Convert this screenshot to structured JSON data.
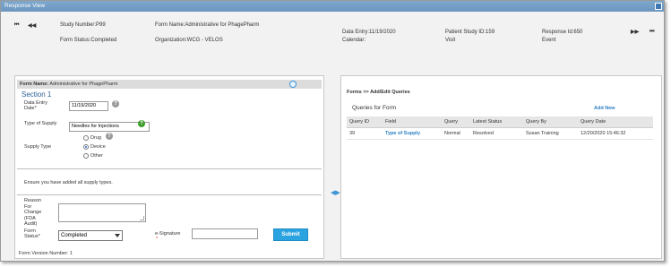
{
  "window": {
    "title": "Response View"
  },
  "header": {
    "study_number": "Study Number:P99",
    "form_name": "Form Name:Administrative for PhagePharm",
    "form_status": "Form Status:Completed",
    "organization": "Organization:WCG - VELOS",
    "data_entry": "Data Entry:11/19/2020",
    "calendar": "Calendar:",
    "patient_study_id": "Patient Study ID:159",
    "visit": "Visit",
    "response_id": "Response Id:650",
    "event": "Event",
    "nav_first": "⏮",
    "nav_prev": "◀◀",
    "nav_next": "▶▶",
    "nav_last": "⏭"
  },
  "form": {
    "name_label": "Form Name:",
    "name_value": "Administrative for PhagePharm",
    "section_title": "Section 1",
    "data_entry_label_1": "Data Entry",
    "data_entry_label_2": "Date*",
    "data_entry_value": "11/19/2020",
    "type_of_supply_label": "Type of Supply",
    "type_of_supply_value": "Needles for Injections",
    "supply_type_label": "Supply Type",
    "supply_options": [
      "Drug",
      "Device",
      "Other"
    ],
    "supply_selected": "Device",
    "note": "Ensure you have added all supply types.",
    "reason_label": [
      "Reason",
      "For",
      "Change",
      "(FDA",
      "Audit)"
    ],
    "form_status_label_1": "Form",
    "form_status_label_2": "Status*",
    "form_status_value": "Completed",
    "esignature_label": "e-Signature",
    "esignature_required": "*",
    "submit_label": "Submit",
    "version": "Form Version Number: 1",
    "help_glyph": "?"
  },
  "queries": {
    "breadcrumb": "Forms >> Add/Edit Queries",
    "title": "Queries for Form",
    "add_new": "Add New",
    "columns": [
      "Query ID",
      "Field",
      "Query",
      "Latest Status",
      "Query By",
      "Query Date"
    ],
    "rows": [
      [
        "39",
        "Type of Supply",
        "Normal",
        "Resolved",
        "Susan Training",
        "12/20/2020 15:46:32"
      ]
    ]
  },
  "colors": {
    "accent": "#2aa3e0",
    "titlebar": "#6b96bf",
    "link": "#2b7fc4",
    "section": "#2b5f96"
  }
}
